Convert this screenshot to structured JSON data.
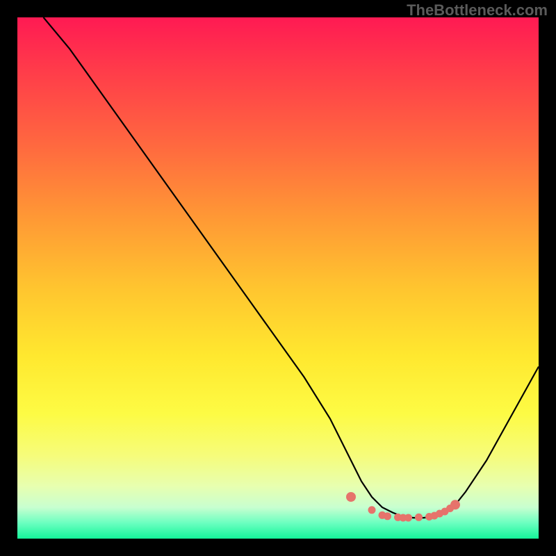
{
  "watermark": "TheBottleneck.com",
  "chart_data": {
    "type": "line",
    "title": "",
    "xlabel": "",
    "ylabel": "",
    "xlim": [
      0,
      100
    ],
    "ylim": [
      0,
      100
    ],
    "series": [
      {
        "name": "bottleneck-curve",
        "x": [
          5,
          10,
          15,
          20,
          25,
          30,
          35,
          40,
          45,
          50,
          55,
          60,
          62,
          64,
          66,
          68,
          70,
          72,
          74,
          76,
          78,
          80,
          82,
          84,
          86,
          90,
          95,
          100
        ],
        "values": [
          100,
          94,
          87,
          80,
          73,
          66,
          59,
          52,
          45,
          38,
          31,
          23,
          19,
          15,
          11,
          8,
          6,
          5,
          4.2,
          4,
          4,
          4.3,
          5,
          6.5,
          9,
          15,
          24,
          33
        ]
      }
    ],
    "markers": {
      "name": "optimal-range-dots",
      "color": "#e6736b",
      "x": [
        64,
        68,
        70,
        71,
        73,
        74,
        75,
        77,
        79,
        80,
        81,
        82,
        83,
        84
      ],
      "values": [
        8,
        5.5,
        4.5,
        4.3,
        4.1,
        4,
        4,
        4.1,
        4.2,
        4.4,
        4.8,
        5.2,
        5.8,
        6.5
      ]
    },
    "gradient": {
      "description": "vertical red-to-green risk gradient",
      "stops": [
        {
          "pos": 0,
          "color": "#ff1a53"
        },
        {
          "pos": 25,
          "color": "#ff6a3f"
        },
        {
          "pos": 52,
          "color": "#ffc52f"
        },
        {
          "pos": 76,
          "color": "#fdfb44"
        },
        {
          "pos": 94,
          "color": "#c8ffd0"
        },
        {
          "pos": 100,
          "color": "#14f59a"
        }
      ]
    }
  }
}
